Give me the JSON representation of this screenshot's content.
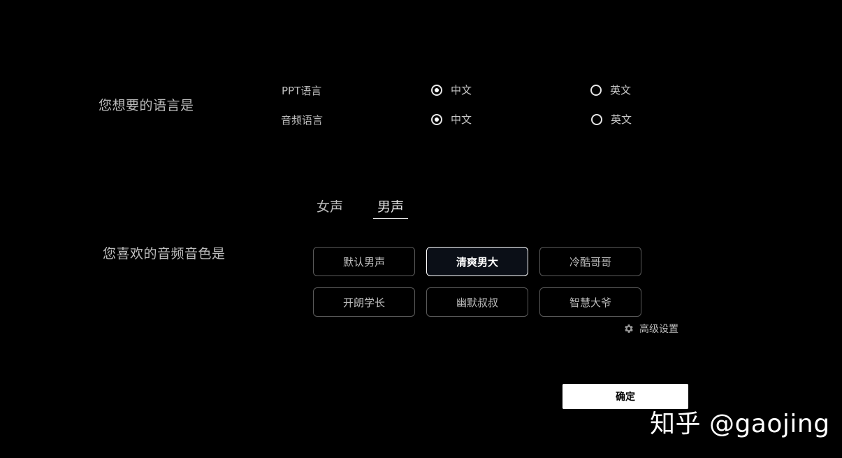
{
  "language": {
    "title": "您想要的语言是",
    "rows": [
      {
        "label": "PPT语言",
        "options": [
          {
            "label": "中文",
            "checked": true
          },
          {
            "label": "英文",
            "checked": false
          }
        ]
      },
      {
        "label": "音频语言",
        "options": [
          {
            "label": "中文",
            "checked": true
          },
          {
            "label": "英文",
            "checked": false
          }
        ]
      }
    ]
  },
  "voice": {
    "title": "您喜欢的音频音色是",
    "tabs": [
      {
        "label": "女声",
        "active": false
      },
      {
        "label": "男声",
        "active": true
      }
    ],
    "options": [
      {
        "label": "默认男声",
        "selected": false
      },
      {
        "label": "清爽男大",
        "selected": true
      },
      {
        "label": "冷酷哥哥",
        "selected": false
      },
      {
        "label": "开朗学长",
        "selected": false
      },
      {
        "label": "幽默叔叔",
        "selected": false
      },
      {
        "label": "智慧大爷",
        "selected": false
      }
    ],
    "advanced_label": "高级设置",
    "advanced_icon": "gear-icon"
  },
  "confirm_label": "确定",
  "watermark": "知乎 @gaojing",
  "colors": {
    "background": "#000000",
    "text": "#bdbdbd",
    "selected_border": "#ffffff",
    "button_border": "#5a5a5a"
  }
}
